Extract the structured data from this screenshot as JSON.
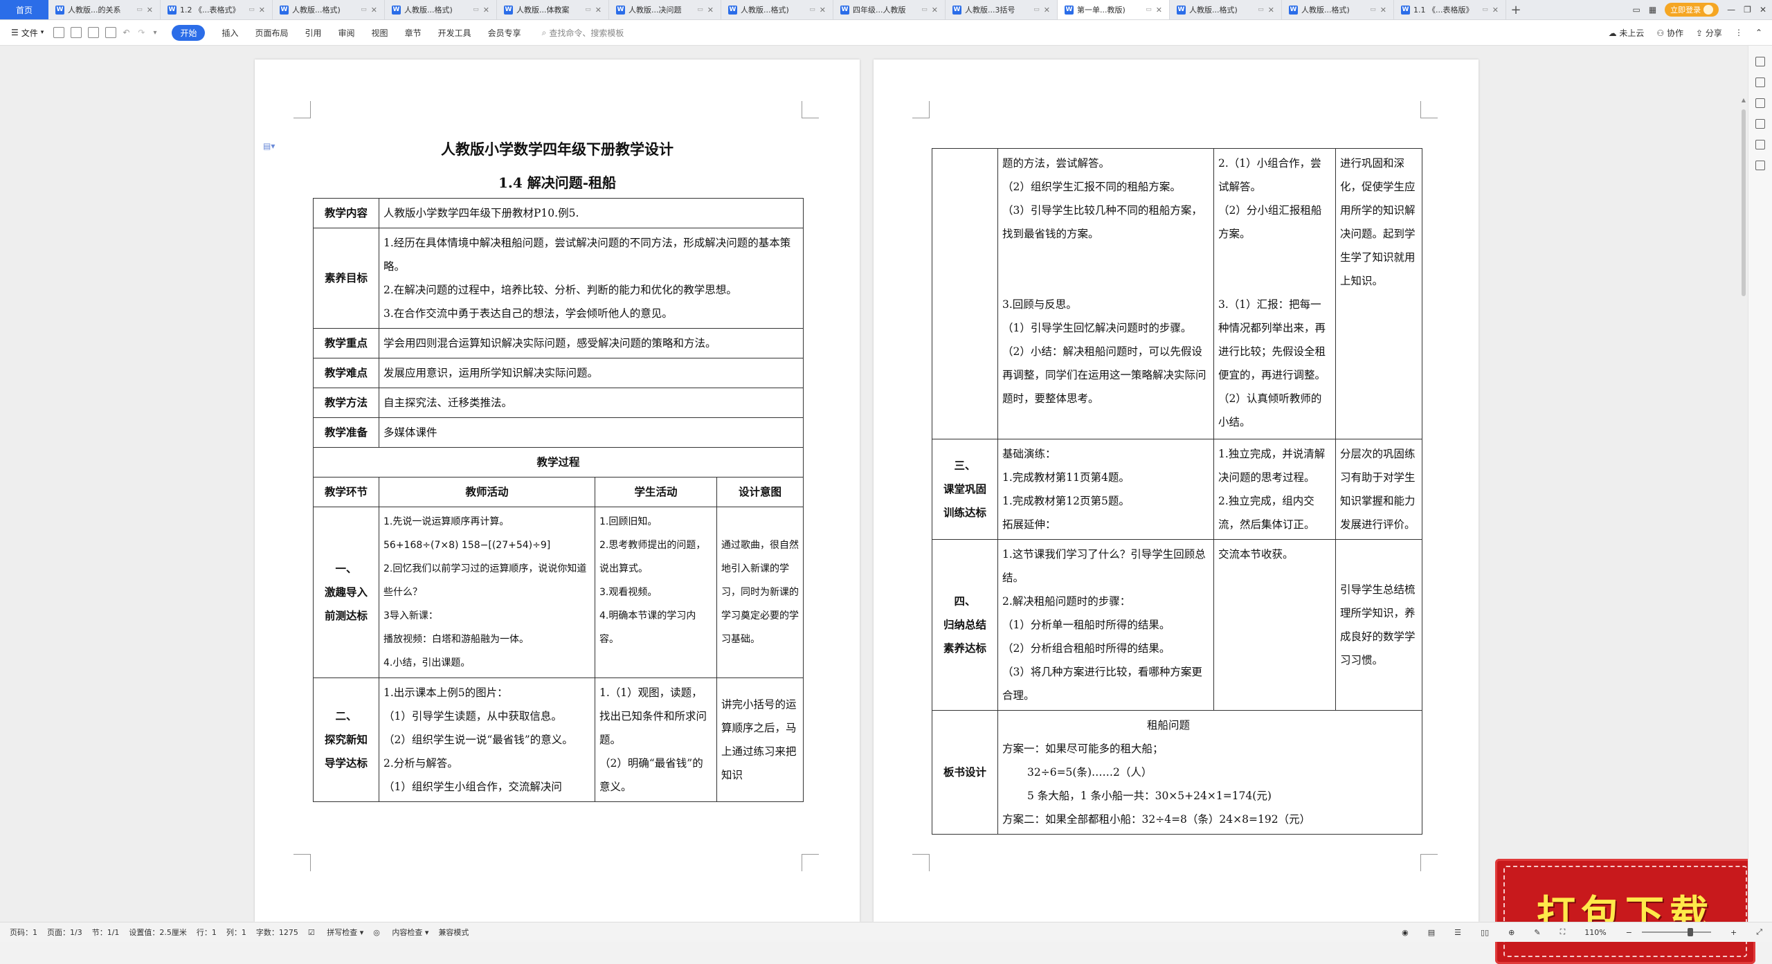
{
  "tabs": {
    "home": "首页",
    "items": [
      {
        "label": "人教版...的关系",
        "active": false
      },
      {
        "label": "1.2 《...表格式》",
        "active": false
      },
      {
        "label": "人教版...格式)",
        "active": false
      },
      {
        "label": "人教版...格式)",
        "active": false
      },
      {
        "label": "人教版...体教案",
        "active": false
      },
      {
        "label": "人教版...决问题",
        "active": false
      },
      {
        "label": "人教版...格式)",
        "active": false
      },
      {
        "label": "四年级...人教版",
        "active": false
      },
      {
        "label": "人教版...3括号",
        "active": false
      },
      {
        "label": "第一单...教版)",
        "active": true
      },
      {
        "label": "人教版...格式)",
        "active": false
      },
      {
        "label": "人教版...格式)",
        "active": false
      },
      {
        "label": "1.1 《...表格版》",
        "active": false
      }
    ],
    "new_tab": "+",
    "login": "立即登录"
  },
  "menu": {
    "file": "文件",
    "items": [
      "开始",
      "插入",
      "页面布局",
      "引用",
      "审阅",
      "视图",
      "章节",
      "开发工具",
      "会员专享"
    ],
    "active": "开始",
    "search_placeholder": "查找命令、搜索模板",
    "right": {
      "cloud": "未上云",
      "collab": "协作",
      "share": "分享"
    }
  },
  "doc": {
    "title": "人教版小学数学四年级下册教学设计",
    "subtitle": "1.4 解决问题-租船",
    "rows": [
      {
        "label": "教学内容",
        "text": [
          "人教版小学数学四年级下册教材P10.例5."
        ]
      },
      {
        "label": "素养目标",
        "text": [
          "1.经历在具体情境中解决租船问题，尝试解决问题的不同方法，形成解决问题的基本策略。",
          "2.在解决问题的过程中，培养比较、分析、判断的能力和优化的教学思想。",
          "3.在合作交流中勇于表达自己的想法，学会倾听他人的意见。"
        ]
      },
      {
        "label": "教学重点",
        "text": [
          "学会用四则混合运算知识解决实际问题，感受解决问题的策略和方法。"
        ]
      },
      {
        "label": "教学难点",
        "text": [
          "发展应用意识，运用所学知识解决实际问题。"
        ]
      },
      {
        "label": "教学方法",
        "text": [
          "自主探究法、迁移类推法。"
        ]
      },
      {
        "label": "教学准备",
        "text": [
          "多媒体课件"
        ]
      }
    ],
    "process_title": "教学过程",
    "process_headers": [
      "教学环节",
      "教师活动",
      "学生活动",
      "设计意图"
    ],
    "stages_p1": [
      {
        "stage": [
          "一、",
          "激趣导入",
          "前测达标"
        ],
        "teacher": [
          "1.先说一说运算顺序再计算。",
          "56+168÷(7×8)    158−[(27+54)÷9]",
          "2.回忆我们以前学习过的运算顺序，说说你知道些什么？",
          "3导入新课：",
          "播放视频：白塔和游船融为一体。",
          "4.小结，引出课题。"
        ],
        "student": [
          "1.回顾旧知。",
          "2.思考教师提出的问题，说出算式。",
          "3.观看视频。",
          "4.明确本节课的学习内容。"
        ],
        "intent": [
          "通过歌曲，很自然地引入新课的学习，同时为新课的学习奠定必要的学习基础。"
        ]
      },
      {
        "stage": [
          "二、",
          "探究新知",
          "导学达标"
        ],
        "teacher": [
          "1.出示课本上例5的图片：",
          "（1）引导学生读题，从中获取信息。",
          "（2）组织学生说一说“最省钱”的意义。",
          "2.分析与解答。",
          "（1）组织学生小组合作，交流解决问"
        ],
        "student": [
          "1.（1）观图，读题，找出已知条件和所求问题。",
          "（2）明确“最省钱”的意义。"
        ],
        "intent": [
          "讲完小括号的运算顺序之后，马上通过练习来把知识"
        ]
      }
    ],
    "cont_teacher_a": [
      "题的方法，尝试解答。",
      "（2）组织学生汇报不同的租船方案。",
      "（3）引导学生比较几种不同的租船方案，找到最省钱的方案。"
    ],
    "cont_teacher_b": [
      "3.回顾与反思。",
      "（1）引导学生回忆解决问题时的步骤。",
      "（2）小结：解决租船问题时，可以先假设再调整，同学们在运用这一策略解决实际问题时，要整体思考。"
    ],
    "cont_student_a": [
      "2.（1）小组合作，尝试解答。",
      "（2）分小组汇报租船方案。"
    ],
    "cont_student_b": [
      "3.（1）汇报：把每一种情况都列举出来，再进行比较；先假设全租便宜的，再进行调整。",
      "（2）认真倾听教师的小结。"
    ],
    "cont_intent": [
      "进行巩固和深化，促使学生应用所学的知识解决问题。起到学生学了知识就用上知识。"
    ],
    "stage3": {
      "stage": [
        "三、",
        "课堂巩固",
        "训练达标"
      ],
      "teacher": [
        "基础演练：",
        "1.完成教材第11页第4题。",
        "1.完成教材第12页第5题。",
        "拓展延伸："
      ],
      "student": [
        "1.独立完成，并说清解决问题的思考过程。",
        "2.独立完成，组内交流，然后集体订正。"
      ],
      "intent": [
        "分层次的巩固练习有助于对学生知识掌握和能力发展进行评价。"
      ]
    },
    "stage4": {
      "stage": [
        "四、",
        "归纳总结",
        "素养达标"
      ],
      "teacher": [
        "1.这节课我们学习了什么？引导学生回顾总结。",
        "2.解决租船问题时的步骤：",
        "（1）分析单一租船时所得的结果。",
        "（2）分析组合租船时所得的结果。",
        "（3）将几种方案进行比较，看哪种方案更合理。"
      ],
      "student": [
        "交流本节收获。"
      ],
      "intent": [
        "引导学生总结梳理所学知识，养成良好的数学学习习惯。"
      ]
    },
    "board": {
      "label": "板书设计",
      "lines": [
        "租船问题",
        "方案一：如果尽可能多的租大船；",
        "32÷6=5(条)……2（人）",
        "5 条大船，1 条小船一共：30×5+24×1=174(元)",
        "方案二：如果全部都租小船：32÷4=8（条）24×8=192（元）"
      ]
    }
  },
  "status": {
    "page_no": "页码：1",
    "pages": "页面：1/3",
    "section": "节：1/1",
    "setting": "设置值：2.5厘米",
    "row": "行：1",
    "col": "列：1",
    "words": "字数：1275",
    "spell": "拼写检查",
    "content_check": "内容检查",
    "compat": "兼容模式",
    "zoom": "110%"
  },
  "banner": {
    "text": "打包下载"
  }
}
